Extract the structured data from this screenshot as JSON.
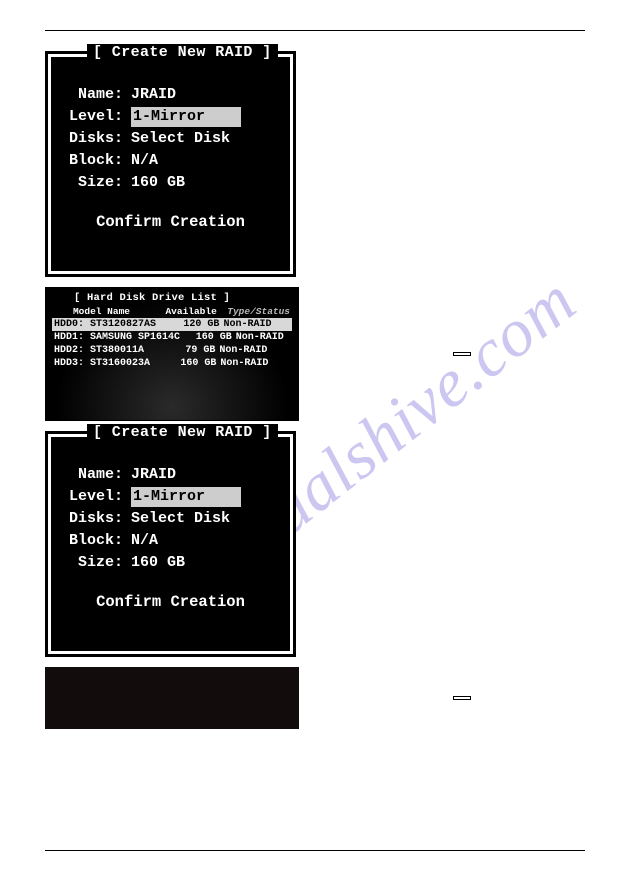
{
  "watermark": "manualshive.com",
  "panels": {
    "create1": {
      "title": "[ Create New RAID ]",
      "name_label": "Name:",
      "name_value": "JRAID",
      "level_label": "Level:",
      "level_value": "1-Mirror",
      "disks_label": "Disks:",
      "disks_value": "Select Disk",
      "block_label": "Block:",
      "block_value": "N/A",
      "size_label": "Size:",
      "size_value": " 160 GB",
      "confirm": "Confirm Creation"
    },
    "hdd_list": {
      "title": "[ Hard Disk Drive List ]",
      "col1": "Model Name",
      "col2": "Available",
      "col3": "Type/Status",
      "rows": [
        {
          "id": "HDD0:",
          "model": "ST3120827AS",
          "size": "120 GB",
          "type": "Non-RAID",
          "selected": true
        },
        {
          "id": "HDD1:",
          "model": "SAMSUNG SP1614C",
          "size": "160 GB",
          "type": "Non-RAID",
          "selected": false
        },
        {
          "id": "HDD2:",
          "model": "ST380011A",
          "size": "79 GB",
          "type": "Non-RAID",
          "selected": false
        },
        {
          "id": "HDD3:",
          "model": "ST3160023A",
          "size": "160 GB",
          "type": "Non-RAID",
          "selected": false
        }
      ]
    },
    "create2": {
      "title": "[ Create New RAID ]",
      "name_label": "Name:",
      "name_value": "JRAID",
      "level_label": "Level:",
      "level_value": "1-Mirror",
      "disks_label": "Disks:",
      "disks_value": "Select Disk",
      "block_label": "Block:",
      "block_value": "N/A",
      "size_label": "Size:",
      "size_value": " 160 GB",
      "confirm": "Confirm Creation"
    }
  },
  "keys": {
    "k1": " ",
    "k2": " "
  }
}
